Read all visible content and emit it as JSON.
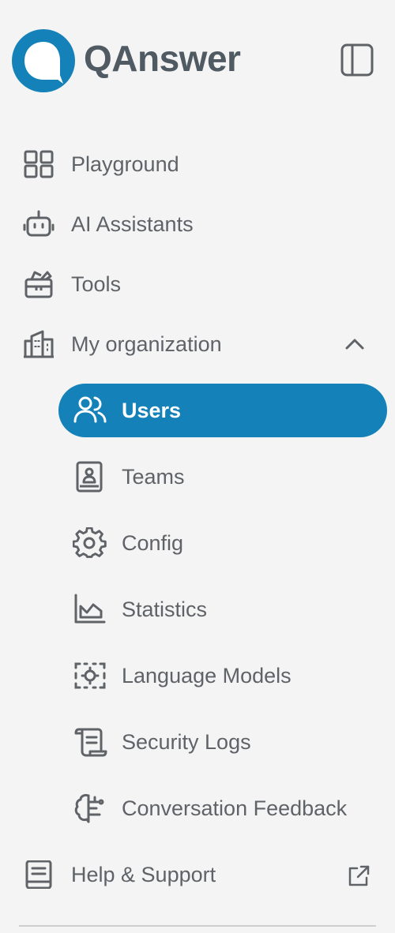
{
  "brand": {
    "name": "QAnswer",
    "accent_color": "#1482b9"
  },
  "header": {
    "collapse_icon": "sidebar-toggle-icon"
  },
  "nav": {
    "items": [
      {
        "label": "Playground",
        "icon": "grid-icon"
      },
      {
        "label": "AI Assistants",
        "icon": "robot-icon"
      },
      {
        "label": "Tools",
        "icon": "toolbox-icon"
      },
      {
        "label": "My organization",
        "icon": "building-icon",
        "expanded": true
      }
    ],
    "org_sub_items": [
      {
        "label": "Users",
        "icon": "users-icon",
        "active": true
      },
      {
        "label": "Teams",
        "icon": "contact-book-icon"
      },
      {
        "label": "Config",
        "icon": "gear-icon"
      },
      {
        "label": "Statistics",
        "icon": "chart-area-icon"
      },
      {
        "label": "Language Models",
        "icon": "cpu-settings-icon"
      },
      {
        "label": "Security Logs",
        "icon": "scroll-icon"
      },
      {
        "label": "Conversation Feedback",
        "icon": "brain-icon"
      }
    ],
    "help": {
      "label": "Help & Support",
      "icon": "book-icon",
      "trailing_icon": "external-link-icon"
    }
  }
}
